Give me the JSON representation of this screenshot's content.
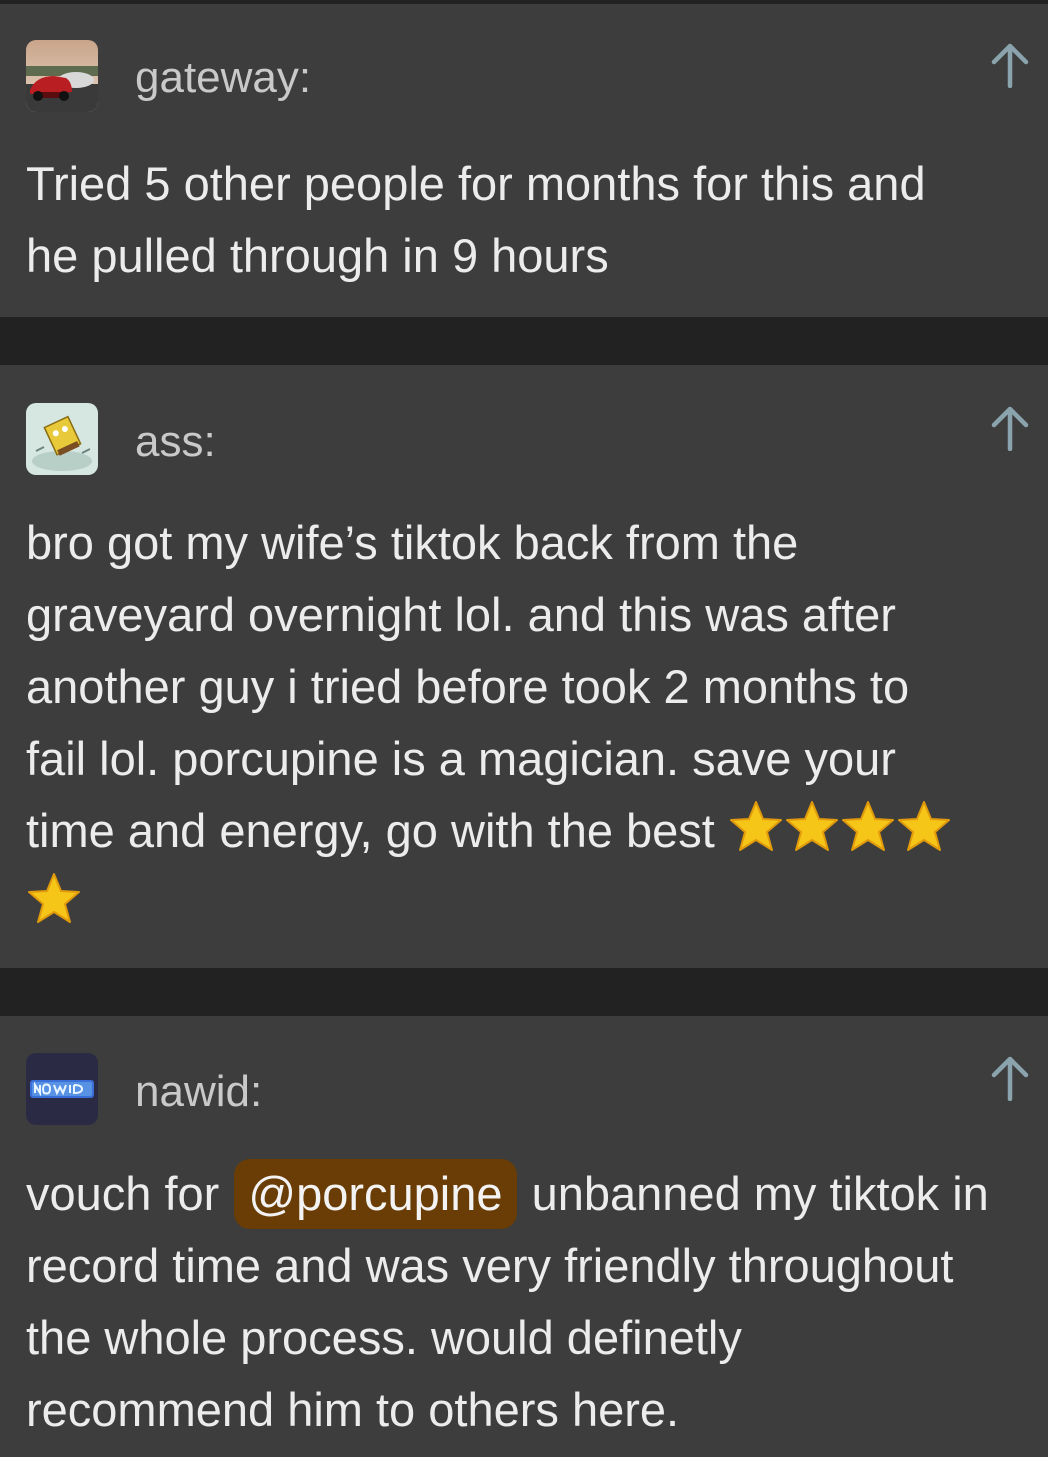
{
  "posts": [
    {
      "username": "gateway:",
      "avatar_icon": "car-photo-avatar-icon",
      "lines": [
        "Tried 5 other people for months for this and",
        "he pulled through in 9 hours"
      ]
    },
    {
      "username": "ass:",
      "avatar_icon": "spongebob-avatar-icon",
      "lines": [
        "bro got my wife’s tiktok back from the",
        "graveyard overnight lol. and this was after",
        "another guy i tried before took 2 months to",
        "fail lol. porcupine is a magician. save your",
        "time and energy, go with the best "
      ],
      "star_emoji_count": 5
    },
    {
      "username": "nawid:",
      "avatar_icon": "nawid-logo-avatar-icon",
      "line1_before": "vouch for",
      "mention": "@porcupine",
      "line1_after": "unbanned my tiktok in",
      "lines": [
        "record time and was very friendly throughout",
        "the whole process. would definetly",
        "recommend him to others here."
      ]
    }
  ],
  "colors": {
    "background": "#222222",
    "card": "#3d3d3d",
    "username": "#c9c9c9",
    "text": "#ececec",
    "upvote_arrow": "#8aa3ad",
    "mention_bg": "#6b3d06",
    "star": "#f5c518"
  }
}
